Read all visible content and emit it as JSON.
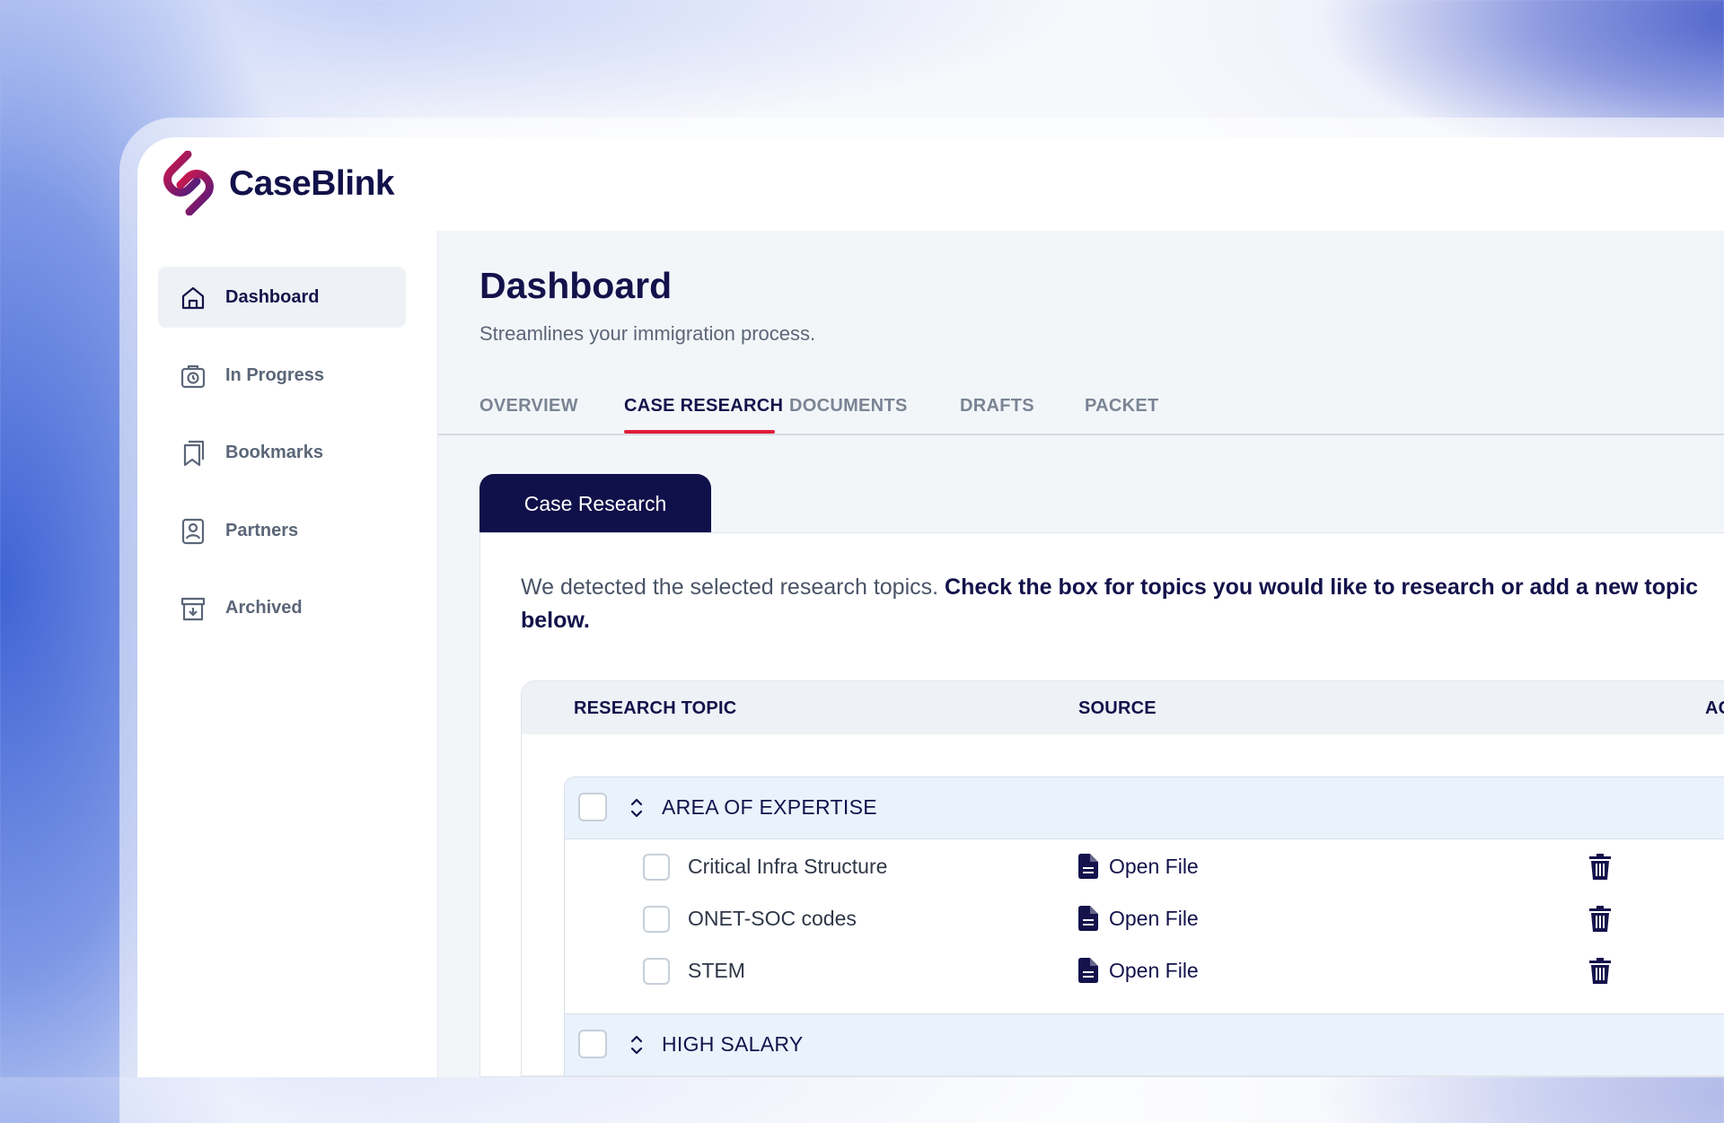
{
  "app": {
    "name": "CaseBlink"
  },
  "sidebar": {
    "items": [
      {
        "label": "Dashboard",
        "icon": "home-icon",
        "active": true
      },
      {
        "label": "In Progress",
        "icon": "timer-bag-icon",
        "active": false
      },
      {
        "label": "Bookmarks",
        "icon": "bookmarks-icon",
        "active": false
      },
      {
        "label": "Partners",
        "icon": "contact-book-icon",
        "active": false
      },
      {
        "label": "Archived",
        "icon": "archive-box-icon",
        "active": false
      }
    ]
  },
  "header": {
    "title": "Dashboard",
    "subtitle": "Streamlines your immigration process."
  },
  "tabs": [
    {
      "label": "OVERVIEW",
      "active": false
    },
    {
      "label": "CASE RESEARCH",
      "active": true
    },
    {
      "label": "DOCUMENTS",
      "active": false
    },
    {
      "label": "DRAFTS",
      "active": false
    },
    {
      "label": "PACKET",
      "active": false
    }
  ],
  "panel": {
    "tab_label": "Case Research",
    "intro_plain": "We detected the selected research topics. ",
    "intro_bold": "Check the box for topics you would like to research or add a new topic below."
  },
  "table": {
    "columns": [
      "RESEARCH TOPIC",
      "SOURCE",
      "AC"
    ],
    "groups": [
      {
        "label": "AREA OF EXPERTISE",
        "rows": [
          {
            "topic": "Critical Infra Structure",
            "source": "Open File"
          },
          {
            "topic": "ONET-SOC codes",
            "source": "Open File"
          },
          {
            "topic": "STEM",
            "source": "Open File"
          }
        ]
      },
      {
        "label": "HIGH SALARY",
        "rows": []
      }
    ]
  },
  "colors": {
    "navy": "#10104a",
    "accent_red": "#e11d3a",
    "group_bg": "#eaf2fc",
    "brand_logo": "#b8154f"
  }
}
